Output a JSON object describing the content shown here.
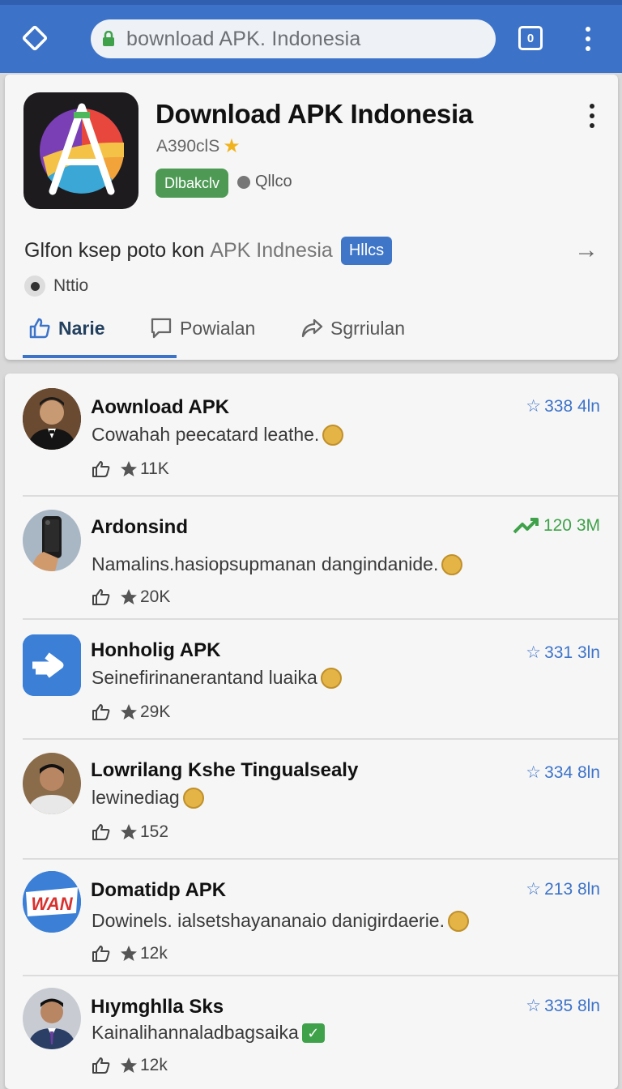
{
  "browser": {
    "url": "bownload APK. Indonesia",
    "tab_count": "0"
  },
  "app": {
    "title": "Download APK Indonesia",
    "subtitle": "A390clS",
    "download_label": "Dlbakclv",
    "secondary_label": "Qllco",
    "description": "Glfon ksep poto kon",
    "description_grey": "APK  Indnesia",
    "badge": "Hllcs",
    "radio_label": "Nttio",
    "tabs": [
      {
        "label": "Narie",
        "icon": "thumbs-up-icon"
      },
      {
        "label": "Powialan",
        "icon": "comment-icon"
      },
      {
        "label": "Sgrriulan",
        "icon": "share-icon"
      }
    ]
  },
  "items": [
    {
      "title": "Aownload APK",
      "subtitle": "Cowahah peecatard leathe.",
      "end": "emoji",
      "count": "11K",
      "stat": "338 4ln",
      "stat_icon": "star-outline-icon",
      "stat_color": "#3c73c9"
    },
    {
      "title": "Ardonsind",
      "subtitle": "Namalins.hasiopsupmanan dangindanide.",
      "end": "emoji",
      "count": "20K",
      "stat": "120 3M",
      "stat_icon": "trend-up-icon",
      "stat_color": "#3fa24a"
    },
    {
      "title": "Honholig APK",
      "subtitle": "Seinefirinanerantand luaika",
      "end": "emoji",
      "count": "29K",
      "stat": "331 3ln",
      "stat_icon": "star-outline-icon",
      "stat_color": "#3c73c9"
    },
    {
      "title": "Lowrilang Kshe Tingualsealy",
      "subtitle": "lewinediag",
      "end": "emoji",
      "count": "152",
      "stat": "334 8ln",
      "stat_icon": "star-outline-icon",
      "stat_color": "#3c73c9"
    },
    {
      "title": "Domatidp APK",
      "subtitle": "Dowinels. ialsetshayananaio danigirdaerie.",
      "end": "emoji",
      "count": "12k",
      "stat": "213 8ln",
      "stat_icon": "star-outline-icon",
      "stat_color": "#3c73c9"
    },
    {
      "title": "Hıymghlla Sks",
      "subtitle": "Kainalihannaladbagsaika",
      "end": "check",
      "count": "12k",
      "stat": "335 8ln",
      "stat_icon": "star-outline-icon",
      "stat_color": "#3c73c9"
    }
  ],
  "avatars": [
    "man-in-suit-avatar",
    "phone-in-hand-avatar",
    "arrow-app-icon",
    "man-portrait-avatar",
    "wan-logo-avatar",
    "man-in-tie-avatar"
  ],
  "logo_text": "WAN"
}
